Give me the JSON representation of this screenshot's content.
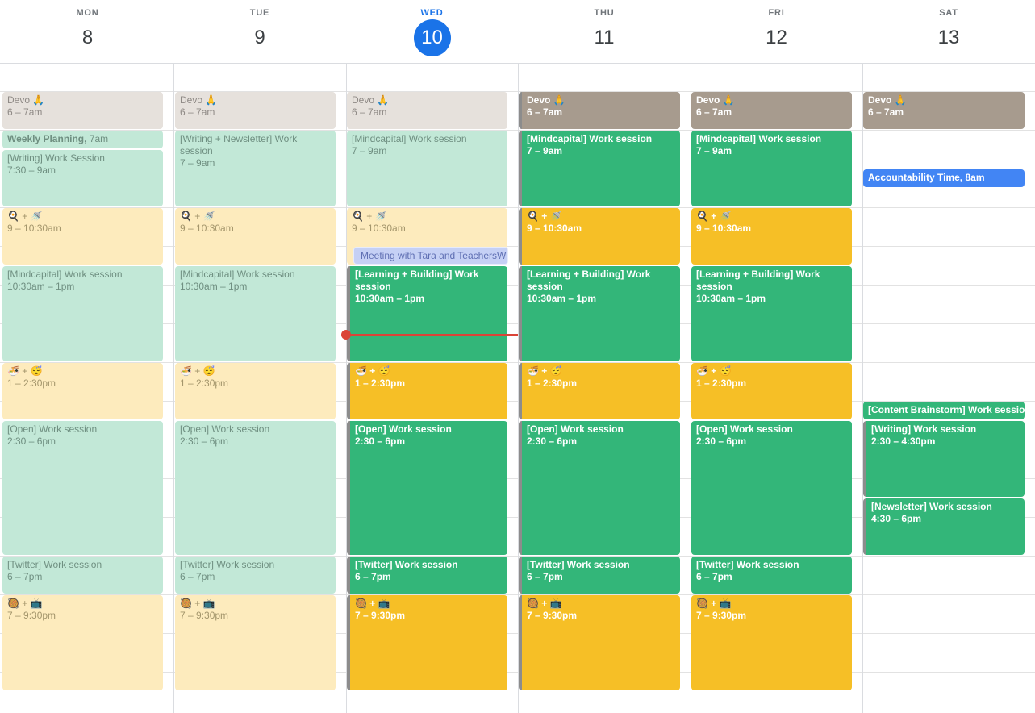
{
  "days": [
    {
      "name": "MON",
      "num": "8"
    },
    {
      "name": "TUE",
      "num": "9"
    },
    {
      "name": "WED",
      "num": "10"
    },
    {
      "name": "THU",
      "num": "11"
    },
    {
      "name": "FRI",
      "num": "12"
    },
    {
      "name": "SAT",
      "num": "13"
    }
  ],
  "today_index": 2,
  "events": {
    "mon": [
      {
        "title": "Devo 🙏",
        "time": "6 – 7am"
      },
      {
        "title": "Weekly Planning,",
        "time": "7am"
      },
      {
        "title": "[Writing] Work Session",
        "time": "7:30 – 9am"
      },
      {
        "title": "🍳 + 🚿",
        "time": "9 – 10:30am"
      },
      {
        "title": "[Mindcapital] Work session",
        "time": "10:30am – 1pm"
      },
      {
        "title": "🍜 + 😴",
        "time": "1 – 2:30pm"
      },
      {
        "title": "[Open] Work session",
        "time": "2:30 – 6pm"
      },
      {
        "title": "[Twitter] Work session",
        "time": "6 – 7pm"
      },
      {
        "title": "🥘 + 📺",
        "time": "7 – 9:30pm"
      }
    ],
    "tue": [
      {
        "title": "Devo 🙏",
        "time": "6 – 7am"
      },
      {
        "title": "[Writing + Newsletter] Work session",
        "time": "7 – 9am"
      },
      {
        "title": "🍳 + 🚿",
        "time": "9 – 10:30am"
      },
      {
        "title": "[Mindcapital] Work session",
        "time": "10:30am – 1pm"
      },
      {
        "title": "🍜 + 😴",
        "time": "1 – 2:30pm"
      },
      {
        "title": "[Open] Work session",
        "time": "2:30 – 6pm"
      },
      {
        "title": "[Twitter] Work session",
        "time": "6 – 7pm"
      },
      {
        "title": "🥘 + 📺",
        "time": "7 – 9:30pm"
      }
    ],
    "wed": [
      {
        "title": "Devo 🙏",
        "time": "6 – 7am"
      },
      {
        "title": "[Mindcapital] Work session",
        "time": "7 – 9am"
      },
      {
        "title": "🍳 + 🚿",
        "time": "9 – 10:30am"
      },
      {
        "title": "Meeting with Tara and TeachersW",
        "time": ""
      },
      {
        "title": "[Learning + Building] Work session",
        "time": "10:30am – 1pm"
      },
      {
        "title": "🍜 + 😴",
        "time": "1 – 2:30pm"
      },
      {
        "title": "[Open] Work session",
        "time": "2:30 – 6pm"
      },
      {
        "title": "[Twitter] Work session",
        "time": "6 – 7pm"
      },
      {
        "title": "🥘 + 📺",
        "time": "7 – 9:30pm"
      }
    ],
    "thu": [
      {
        "title": "Devo 🙏",
        "time": "6 – 7am"
      },
      {
        "title": "[Mindcapital] Work session",
        "time": "7 – 9am"
      },
      {
        "title": "🍳 + 🚿",
        "time": "9 – 10:30am"
      },
      {
        "title": "[Learning + Building] Work session",
        "time": "10:30am – 1pm"
      },
      {
        "title": "🍜 + 😴",
        "time": "1 – 2:30pm"
      },
      {
        "title": "[Open] Work session",
        "time": "2:30 – 6pm"
      },
      {
        "title": "[Twitter] Work session",
        "time": "6 – 7pm"
      },
      {
        "title": "🥘 + 📺",
        "time": "7 – 9:30pm"
      }
    ],
    "fri": [
      {
        "title": "Devo 🙏",
        "time": "6 – 7am"
      },
      {
        "title": "[Mindcapital] Work session",
        "time": "7 – 9am"
      },
      {
        "title": "🍳 + 🚿",
        "time": "9 – 10:30am"
      },
      {
        "title": "[Learning + Building] Work session",
        "time": "10:30am – 1pm"
      },
      {
        "title": "🍜 + 😴",
        "time": "1 – 2:30pm"
      },
      {
        "title": "[Open] Work session",
        "time": "2:30 – 6pm"
      },
      {
        "title": "[Twitter] Work session",
        "time": "6 – 7pm"
      },
      {
        "title": "🥘 + 📺",
        "time": "7 – 9:30pm"
      }
    ],
    "sat": [
      {
        "title": "Devo 🙏",
        "time": "6 – 7am"
      },
      {
        "title": "Accountability Time,",
        "time": "8am"
      },
      {
        "title": "[Content Brainstorm] Work session,",
        "time": ""
      },
      {
        "title": "[Writing] Work session",
        "time": "2:30 – 4:30pm"
      },
      {
        "title": "[Newsletter] Work session",
        "time": "4:30 – 6pm"
      }
    ]
  },
  "colors": {
    "today_accent": "#1a73e8",
    "green": "#33b679",
    "yellow": "#f6bf26",
    "brown": "#a79b8e",
    "blue": "#4285f4",
    "now_line": "#db4437"
  }
}
